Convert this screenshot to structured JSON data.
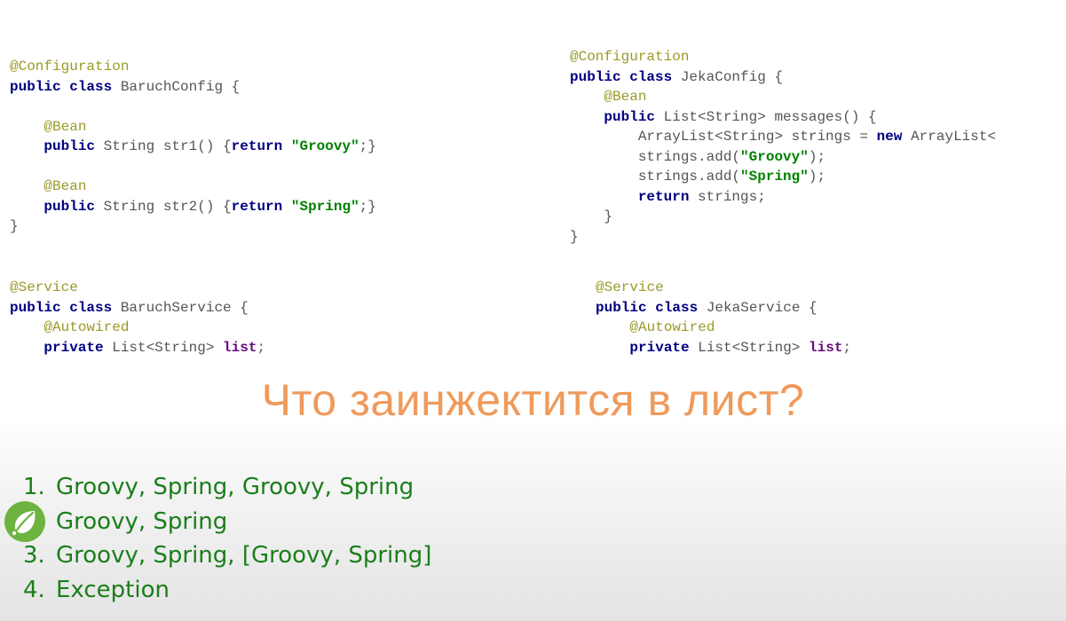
{
  "colors": {
    "annotation": "#9a9a2a",
    "keyword": "#000080",
    "string": "#008000",
    "question": "#ef9a5b",
    "answer": "#1a7f1a",
    "spring_logo": "#6db33f"
  },
  "code": {
    "baruch_config": [
      [
        {
          "t": "ann",
          "s": "@Configuration"
        }
      ],
      [
        {
          "t": "kw",
          "s": "public class"
        },
        {
          "t": "plain",
          "s": " BaruchConfig {"
        }
      ],
      [],
      [
        {
          "t": "plain",
          "s": "    "
        },
        {
          "t": "ann",
          "s": "@Bean"
        }
      ],
      [
        {
          "t": "plain",
          "s": "    "
        },
        {
          "t": "kw",
          "s": "public"
        },
        {
          "t": "plain",
          "s": " String str1() {"
        },
        {
          "t": "kw",
          "s": "return"
        },
        {
          "t": "plain",
          "s": " "
        },
        {
          "t": "str",
          "s": "\"Groovy\""
        },
        {
          "t": "plain",
          "s": ";}"
        }
      ],
      [],
      [
        {
          "t": "plain",
          "s": "    "
        },
        {
          "t": "ann",
          "s": "@Bean"
        }
      ],
      [
        {
          "t": "plain",
          "s": "    "
        },
        {
          "t": "kw",
          "s": "public"
        },
        {
          "t": "plain",
          "s": " String str2() {"
        },
        {
          "t": "kw",
          "s": "return"
        },
        {
          "t": "plain",
          "s": " "
        },
        {
          "t": "str",
          "s": "\"Spring\""
        },
        {
          "t": "plain",
          "s": ";}"
        }
      ],
      [
        {
          "t": "plain",
          "s": "}"
        }
      ]
    ],
    "jeka_config": [
      [
        {
          "t": "ann",
          "s": "@Configuration"
        }
      ],
      [
        {
          "t": "kw",
          "s": "public class"
        },
        {
          "t": "plain",
          "s": " JekaConfig {"
        }
      ],
      [
        {
          "t": "plain",
          "s": "    "
        },
        {
          "t": "ann",
          "s": "@Bean"
        }
      ],
      [
        {
          "t": "plain",
          "s": "    "
        },
        {
          "t": "kw",
          "s": "public"
        },
        {
          "t": "plain",
          "s": " List<String> messages() {"
        }
      ],
      [
        {
          "t": "plain",
          "s": "        ArrayList<String> strings = "
        },
        {
          "t": "kw",
          "s": "new"
        },
        {
          "t": "plain",
          "s": " ArrayList<"
        }
      ],
      [
        {
          "t": "plain",
          "s": "        strings.add("
        },
        {
          "t": "str",
          "s": "\"Groovy\""
        },
        {
          "t": "plain",
          "s": ");"
        }
      ],
      [
        {
          "t": "plain",
          "s": "        strings.add("
        },
        {
          "t": "str",
          "s": "\"Spring\""
        },
        {
          "t": "plain",
          "s": ");"
        }
      ],
      [
        {
          "t": "plain",
          "s": "        "
        },
        {
          "t": "kw",
          "s": "return"
        },
        {
          "t": "plain",
          "s": " strings;"
        }
      ],
      [
        {
          "t": "plain",
          "s": "    }"
        }
      ],
      [
        {
          "t": "plain",
          "s": "}"
        }
      ]
    ],
    "baruch_service": [
      [
        {
          "t": "ann",
          "s": "@Service"
        }
      ],
      [
        {
          "t": "kw",
          "s": "public class"
        },
        {
          "t": "plain",
          "s": " BaruchService {"
        }
      ],
      [
        {
          "t": "plain",
          "s": "    "
        },
        {
          "t": "ann",
          "s": "@Autowired"
        }
      ],
      [
        {
          "t": "plain",
          "s": "    "
        },
        {
          "t": "kw",
          "s": "private"
        },
        {
          "t": "plain",
          "s": " List<String> "
        },
        {
          "t": "field",
          "s": "list"
        },
        {
          "t": "plain",
          "s": ";"
        }
      ]
    ],
    "jeka_service": [
      [
        {
          "t": "ann",
          "s": "@Service"
        }
      ],
      [
        {
          "t": "kw",
          "s": "public class"
        },
        {
          "t": "plain",
          "s": " JekaService {"
        }
      ],
      [
        {
          "t": "plain",
          "s": "    "
        },
        {
          "t": "ann",
          "s": "@Autowired"
        }
      ],
      [
        {
          "t": "plain",
          "s": "    "
        },
        {
          "t": "kw",
          "s": "private"
        },
        {
          "t": "plain",
          "s": " List<String> "
        },
        {
          "t": "field",
          "s": "list"
        },
        {
          "t": "plain",
          "s": ";"
        }
      ]
    ]
  },
  "question": "Что заинжектится в лист?",
  "answers": [
    {
      "num": "1.",
      "text": "Groovy, Spring, Groovy, Spring"
    },
    {
      "num": "",
      "text": "Groovy, Spring",
      "marked": true
    },
    {
      "num": "3.",
      "text": "Groovy, Spring, [Groovy, Spring]"
    },
    {
      "num": "4.",
      "text": "Exception"
    }
  ],
  "marker_icon": "spring-leaf-logo-icon"
}
